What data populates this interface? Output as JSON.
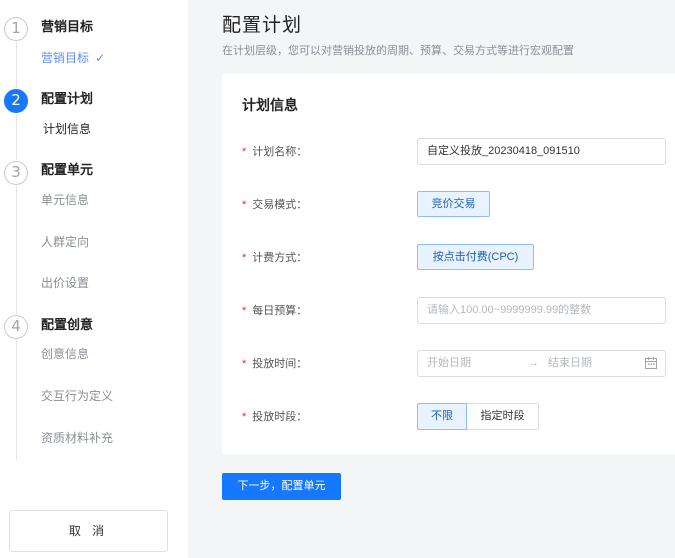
{
  "sidebar": {
    "steps": [
      {
        "number": "1",
        "title": "营销目标",
        "sub": [
          {
            "label": "营销目标",
            "check": "✓"
          }
        ]
      },
      {
        "number": "2",
        "title": "配置计划",
        "sub": [
          {
            "label": "计划信息"
          }
        ]
      },
      {
        "number": "3",
        "title": "配置单元",
        "sub": [
          {
            "label": "单元信息"
          },
          {
            "label": "人群定向"
          },
          {
            "label": "出价设置"
          }
        ]
      },
      {
        "number": "4",
        "title": "配置创意",
        "sub": [
          {
            "label": "创意信息"
          },
          {
            "label": "交互行为定义"
          },
          {
            "label": "资质材料补充"
          }
        ]
      }
    ],
    "cancel_label": "取 消"
  },
  "main": {
    "title": "配置计划",
    "subtitle": "在计划层级，您可以对营销投放的周期、预算、交易方式等进行宏观配置",
    "card_title": "计划信息",
    "required_mark": "*",
    "fields": {
      "plan_name": {
        "label": "计划名称：",
        "value": "自定义投放_20230418_091510"
      },
      "trade_mode": {
        "label": "交易模式：",
        "value": "竞价交易"
      },
      "billing": {
        "label": "计费方式：",
        "value": "按点击付费(CPC)"
      },
      "daily_budget": {
        "label": "每日预算：",
        "placeholder": "请输入100.00~9999999.99的整数"
      },
      "delivery_time": {
        "label": "投放时间：",
        "start_placeholder": "开始日期",
        "arrow": "→",
        "end_placeholder": "结束日期"
      },
      "time_slot": {
        "label": "投放时段：",
        "options": [
          "不限",
          "指定时段"
        ],
        "selected": "不限"
      }
    },
    "next_button": "下一步，配置单元"
  },
  "colors": {
    "accent": "#1677ff",
    "required": "#f5222d",
    "done": "#5b8ff9"
  }
}
